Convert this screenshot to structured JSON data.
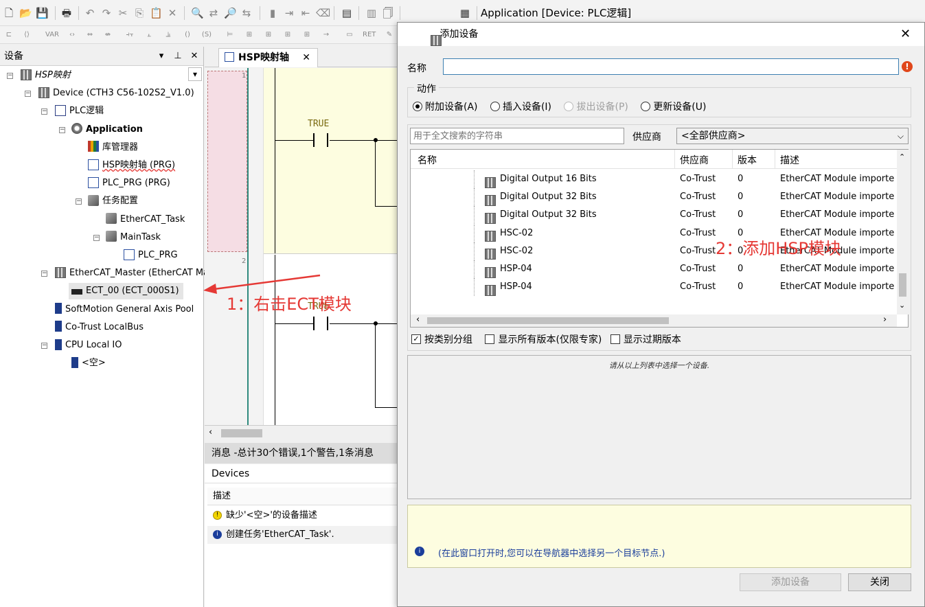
{
  "toolbar": {
    "app_combo": "Application [Device: PLC逻辑]",
    "icons": [
      "new-icon",
      "open-icon",
      "save-icon",
      "print-icon",
      "undo-icon",
      "redo-icon",
      "cut-icon",
      "copy-icon",
      "paste-icon",
      "delete-icon",
      "find-icon",
      "replace-icon",
      "binoculars-icon",
      "find-replace-icon",
      "bookmark-icon",
      "bookmark-next-icon",
      "bookmark-prev-icon",
      "bookmark-clear-icon",
      "clipboard-icon",
      "device-icon",
      "file-icon",
      "calendar-icon"
    ]
  },
  "left_panel": {
    "title": "设备",
    "tree": [
      {
        "label": "HSP映射",
        "italic": true
      },
      {
        "label": "Device (CTH3 C56-102S2_V1.0)"
      },
      {
        "label": "PLC逻辑"
      },
      {
        "label": "Application",
        "bold": true
      },
      {
        "label": "库管理器"
      },
      {
        "label": "HSP映射轴 (PRG)"
      },
      {
        "label": "PLC_PRG (PRG)"
      },
      {
        "label": "任务配置"
      },
      {
        "label": "EtherCAT_Task"
      },
      {
        "label": "MainTask"
      },
      {
        "label": "PLC_PRG"
      },
      {
        "label": "EtherCAT_Master (EtherCAT Ma"
      },
      {
        "label": "ECT_00 (ECT_000S1)"
      },
      {
        "label": "SoftMotion General Axis Pool"
      },
      {
        "label": "Co-Trust LocalBus"
      },
      {
        "label": "CPU Local IO"
      },
      {
        "label": "<空>"
      }
    ]
  },
  "editor": {
    "tab_label": "HSP映射轴",
    "line1": "1",
    "line2": "2",
    "contact1": "TRUE",
    "contact2": "TRUE"
  },
  "messages": {
    "bar": "消息 -总计30个错误,1个警告,1条消息",
    "category": "Devices",
    "column": "描述",
    "items": [
      {
        "text": "缺少'<空>'的设备描述"
      },
      {
        "text": "创建任务'EtherCAT_Task'."
      }
    ]
  },
  "dialog": {
    "title": "添加设备",
    "name_label": "名称",
    "name_value": "",
    "action_label": "动作",
    "actions": [
      "附加设备(A)",
      "插入设备(I)",
      "拔出设备(P)",
      "更新设备(U)"
    ],
    "search_placeholder": "用于全文搜索的字符串",
    "vendor_label": "供应商",
    "vendor_value": "<全部供应商>",
    "columns": [
      "名称",
      "供应商",
      "版本",
      "描述"
    ],
    "rows": [
      {
        "name": "Digital Output 16 Bits",
        "vendor": "Co-Trust",
        "version": "0",
        "desc": "EtherCAT Module imported"
      },
      {
        "name": "Digital Output 32 Bits",
        "vendor": "Co-Trust",
        "version": "0",
        "desc": "EtherCAT Module imported"
      },
      {
        "name": "Digital Output 32 Bits",
        "vendor": "Co-Trust",
        "version": "0",
        "desc": "EtherCAT Module imported"
      },
      {
        "name": "HSC-02",
        "vendor": "Co-Trust",
        "version": "0",
        "desc": "EtherCAT Module imported"
      },
      {
        "name": "HSC-02",
        "vendor": "Co-Trust",
        "version": "0",
        "desc": "EtherCAT Module imported"
      },
      {
        "name": "HSP-04",
        "vendor": "Co-Trust",
        "version": "0",
        "desc": "EtherCAT Module imported"
      },
      {
        "name": "HSP-04",
        "vendor": "Co-Trust",
        "version": "0",
        "desc": "EtherCAT Module imported"
      }
    ],
    "options": [
      "按类别分组",
      "显示所有版本(仅限专家)",
      "显示过期版本"
    ],
    "detail_text": "请从以上列表中选择一个设备.",
    "info_text": "(在此窗口打开时,您可以在导航器中选择另一个目标节点.)",
    "add_button": "添加设备",
    "close_button": "关闭"
  },
  "annotations": {
    "step1": "1：右击ECT模块",
    "step2": "2：添加HSP模块",
    "color": "#e53935"
  }
}
